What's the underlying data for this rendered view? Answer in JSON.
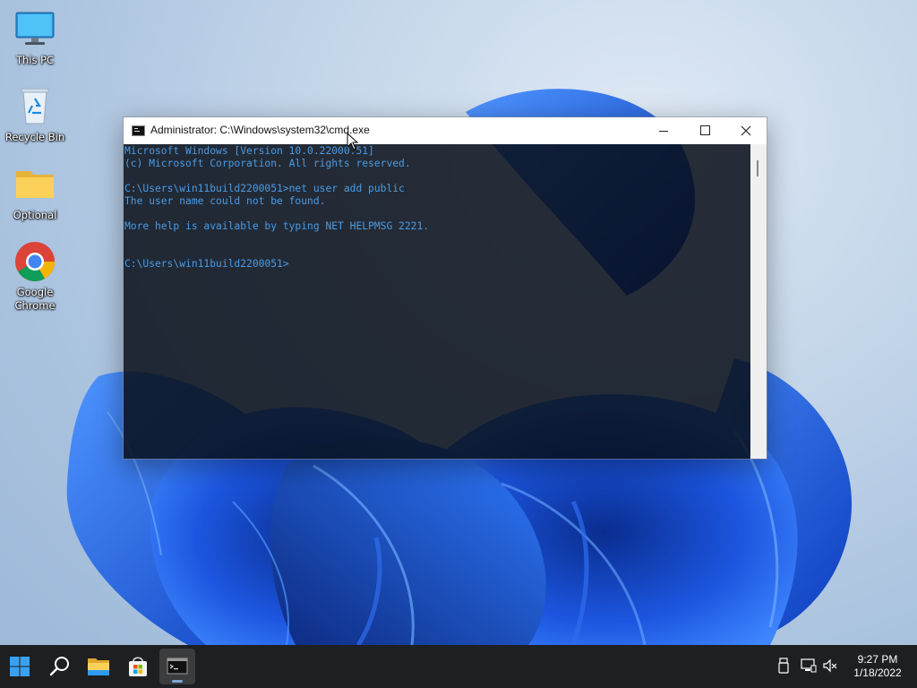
{
  "desktop": {
    "icons": [
      {
        "label": "This PC",
        "icon": "monitor-icon"
      },
      {
        "label": "Recycle Bin",
        "icon": "recycle-bin-icon"
      },
      {
        "label": "Optional",
        "icon": "folder-icon"
      },
      {
        "label": "Google Chrome",
        "icon": "chrome-icon"
      }
    ]
  },
  "window": {
    "title": "Administrator: C:\\Windows\\system32\\cmd.exe",
    "icon": "cmd-icon",
    "controls": {
      "minimize": "minimize-icon",
      "maximize": "maximize-icon",
      "close": "close-icon"
    },
    "text_color": "#4b9be3",
    "lines": [
      "Microsoft Windows [Version 10.0.22000.51]",
      "(c) Microsoft Corporation. All rights reserved.",
      "",
      "C:\\Users\\win11build2200051>net user add public",
      "The user name could not be found.",
      "",
      "More help is available by typing NET HELPMSG 2221.",
      "",
      "",
      "C:\\Users\\win11build2200051>"
    ]
  },
  "taskbar": {
    "apps": [
      {
        "name": "Start",
        "icon": "windows-logo-icon"
      },
      {
        "name": "Search",
        "icon": "search-icon"
      },
      {
        "name": "File Explorer",
        "icon": "file-explorer-icon"
      },
      {
        "name": "Microsoft Store",
        "icon": "store-icon"
      },
      {
        "name": "Command Prompt",
        "icon": "terminal-icon",
        "active": true
      }
    ],
    "tray": [
      "usb-drive-icon",
      "network-icon",
      "volume-muted-icon"
    ],
    "clock": {
      "time": "9:27 PM",
      "date": "1/18/2022"
    }
  },
  "colors": {
    "accent": "#0067c0",
    "taskbar": "#1d1f21",
    "console_text": "#4b9be3"
  }
}
